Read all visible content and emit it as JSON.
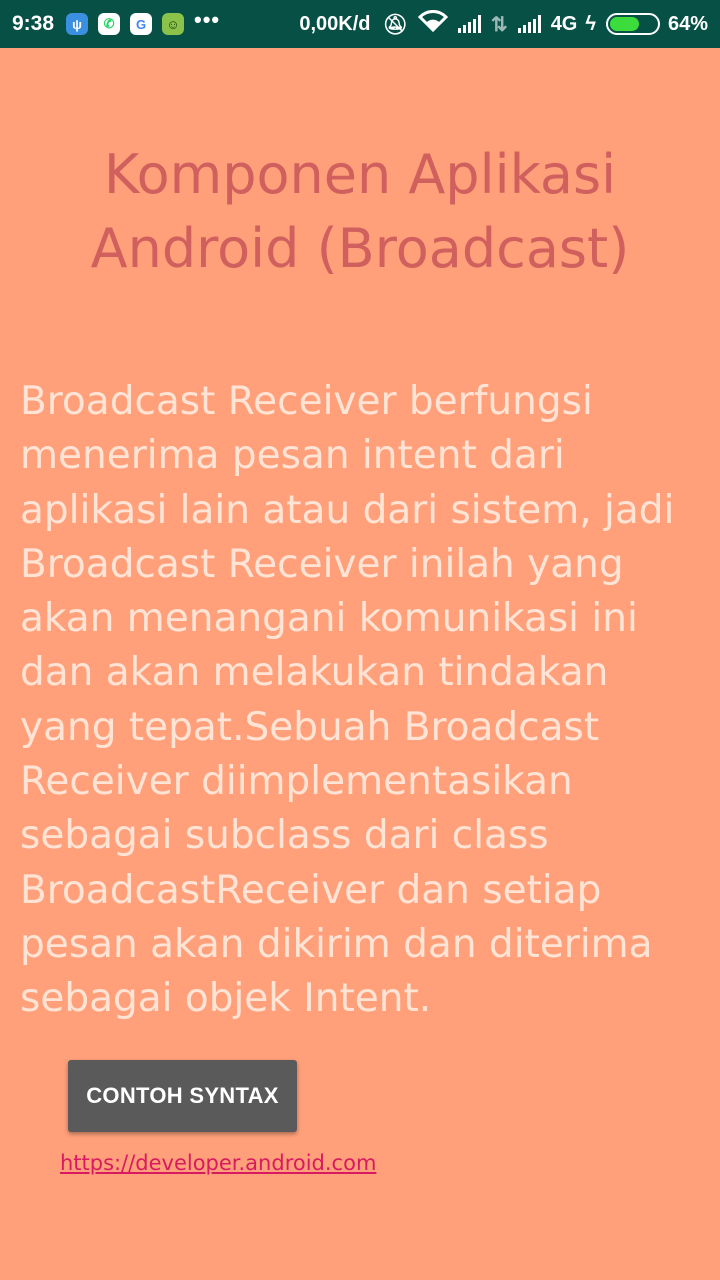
{
  "status_bar": {
    "time": "9:38",
    "more": "•••",
    "speed": "0,00K/d",
    "network": "4G",
    "battery_percent": "64%",
    "battery_level": 0.64,
    "icons": [
      "usb-debug-icon",
      "whatsapp-icon",
      "google-icon",
      "hike-icon",
      "mute-icon",
      "wifi-icon",
      "signal-icon",
      "data-arrows-icon",
      "charging-icon",
      "battery-icon"
    ]
  },
  "page": {
    "title": "Komponen Aplikasi Android (Broadcast)",
    "body": "Broadcast Receiver berfungsi menerima pesan intent dari aplikasi lain atau dari sistem, jadi Broadcast Receiver inilah yang akan menangani komunikasi ini dan akan melakukan tindakan yang tepat.Sebuah Broadcast Receiver diimplementasikan sebagai subclass dari class BroadcastReceiver dan setiap pesan akan dikirim dan diterima sebagai objek Intent.",
    "button_label": "CONTOH SYNTAX",
    "link_text": "https://developer.android.com"
  },
  "colors": {
    "background": "#FFA07A",
    "status_bar": "#075046",
    "title": "#D0605E",
    "body_text": "#FFE4D6",
    "button": "#5A5A5A",
    "link": "#D81B60"
  }
}
